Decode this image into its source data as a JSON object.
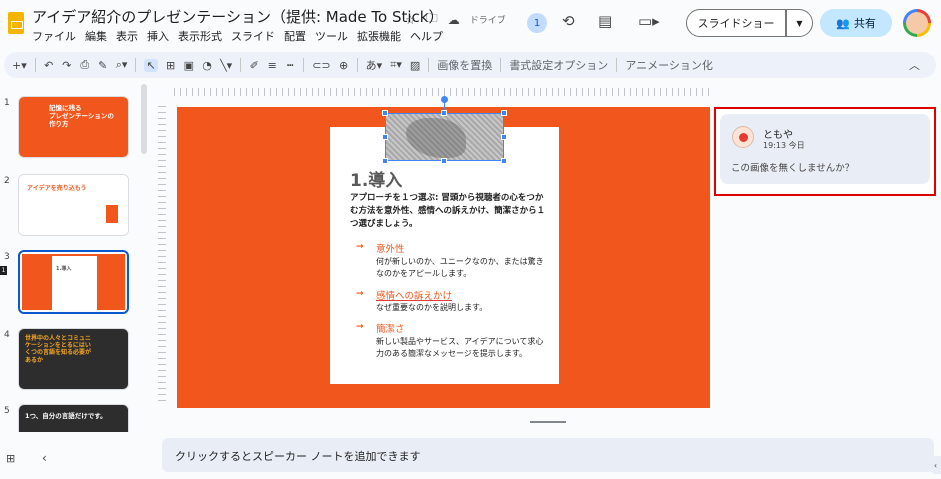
{
  "doc": {
    "title": "アイデア紹介のプレゼンテーション（提供: Made To Stick）",
    "drive_label": "ドライブ"
  },
  "menu": [
    "ファイル",
    "編集",
    "表示",
    "挿入",
    "表示形式",
    "スライド",
    "配置",
    "ツール",
    "拡張機能",
    "ヘルプ"
  ],
  "header": {
    "viewers_count": "1",
    "slideshow_label": "スライドショー",
    "share_label": "共有"
  },
  "toolbar": {
    "replace_image": "画像を置換",
    "format_options": "書式設定オプション",
    "animate": "アニメーション化"
  },
  "slides": [
    {
      "num": "1",
      "text": "記憶に残る\nプレゼンテーションの\n作り方",
      "theme": "orange"
    },
    {
      "num": "2",
      "text": "アイデアを売り込もう",
      "theme": "white"
    },
    {
      "num": "3",
      "text": "1.導入",
      "theme": "orange"
    },
    {
      "num": "4",
      "text": "世界中の人々とコミュニケーションをとるにはいくつの言語を知る必要があるか",
      "theme": "dark"
    },
    {
      "num": "5",
      "text": "1つ、自分の言語だけです。",
      "theme": "dark"
    }
  ],
  "current_slide_marker": "1",
  "slide": {
    "title": "1.導入",
    "lead": "アプローチを１つ選ぶ: 冒頭から視聴者の心をつかむ方法を意外性、感情への訴えかけ、簡潔さから１つ選びましょう。",
    "bullets": [
      {
        "arrow": "→",
        "head": "意外性",
        "body": "何が新しいのか、ユニークなのか、または驚きなのかをアピールします。"
      },
      {
        "arrow": "→",
        "head": "感情への訴えかけ",
        "body": "なぜ重要なのかを説明します。"
      },
      {
        "arrow": "→",
        "head": "簡潔さ",
        "body": "新しい製品やサービス、アイデアについて求心力のある簡潔なメッセージを提示します。"
      }
    ]
  },
  "comment": {
    "author": "ともや",
    "time": "19:13 今日",
    "text": "この画像を無くしませんか？"
  },
  "notes": {
    "placeholder": "クリックするとスピーカー ノートを追加できます"
  },
  "colors": {
    "accent": "#f1571c",
    "selection": "#4285f4",
    "highlight_border": "#dd0000"
  }
}
